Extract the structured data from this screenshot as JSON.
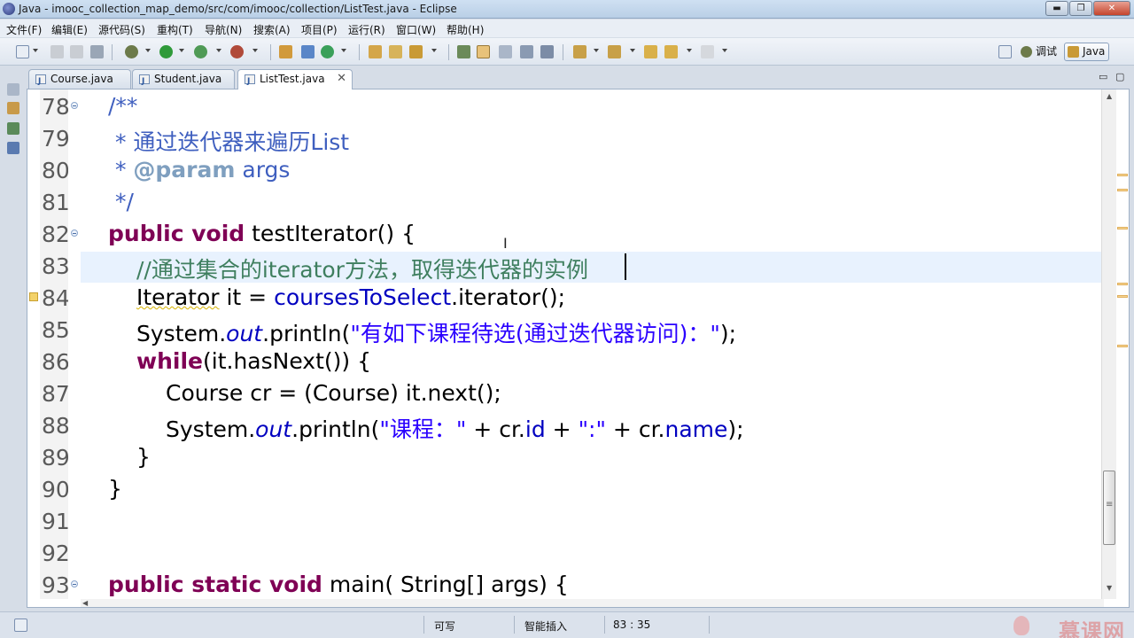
{
  "window": {
    "title": "Java - imooc_collection_map_demo/src/com/imooc/collection/ListTest.java - Eclipse",
    "min_label": "▬",
    "max_label": "❐",
    "close_label": "✕"
  },
  "menu": [
    "文件(F)",
    "编辑(E)",
    "源代码(S)",
    "重构(T)",
    "导航(N)",
    "搜索(A)",
    "项目(P)",
    "运行(R)",
    "窗口(W)",
    "帮助(H)"
  ],
  "perspectives": {
    "debug_label": "调试",
    "java_label": "Java"
  },
  "tabs": [
    {
      "label": "Course.java"
    },
    {
      "label": "Student.java"
    },
    {
      "label": "ListTest.java",
      "active": true
    }
  ],
  "editor": {
    "line_numbers": [
      "78",
      "79",
      "80",
      "81",
      "82",
      "83",
      "84",
      "85",
      "86",
      "87",
      "88",
      "89",
      "90",
      "91",
      "92",
      "93"
    ],
    "current_line": "83",
    "code": {
      "l78": "/**",
      "l79": " * 通过迭代器来遍历List",
      "l80_tag": "@param",
      "l80_rest": " args",
      "l81": " */",
      "l82_kw": "public void",
      "l82_rest": " testIterator() {",
      "l83": "//通过集合的iterator方法，取得迭代器的实例",
      "l84_type": "Iterator",
      "l84_mid": " it = ",
      "l84_field": "coursesToSelect",
      "l84_end": ".iterator();",
      "l85_a": "System.",
      "l85_out": "out",
      "l85_b": ".println(",
      "l85_str": "\"有如下课程待选(通过迭代器访问)：\"",
      "l85_end": ");",
      "l86_kw": "while",
      "l86_rest": "(it.hasNext()) {",
      "l87": "Course cr = (Course) it.next();",
      "l88_a": "System.",
      "l88_out": "out",
      "l88_b": ".println(",
      "l88_str1": "\"课程：\"",
      "l88_c": " + cr.",
      "l88_id": "id",
      "l88_d": " + ",
      "l88_str2": "\":\"",
      "l88_e": " + cr.",
      "l88_name": "name",
      "l88_end": ");",
      "l89": "}",
      "l90": "}",
      "l93_kw": "public static void",
      "l93_rest": " main( String[] args) {"
    }
  },
  "status": {
    "writable": "可写",
    "insert_mode": "智能插入",
    "position": "83 : 35"
  },
  "watermark": "慕课网",
  "colors": {
    "keyword": "#7f0055",
    "javadoc": "#3f5fbf",
    "comment": "#3f7f5f",
    "string": "#2a00ff",
    "field": "#0000c0",
    "current_line_bg": "#e8f2fe"
  }
}
